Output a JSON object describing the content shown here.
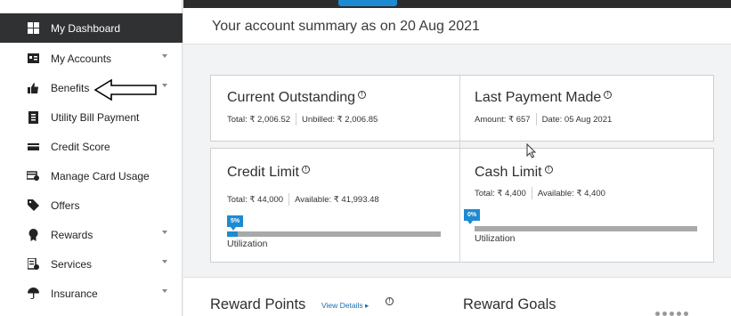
{
  "sidebar": {
    "items": [
      {
        "label": "My Dashboard",
        "icon": "dashboard-grid-icon",
        "active": true,
        "expandable": false
      },
      {
        "label": "My Accounts",
        "icon": "accounts-card-icon",
        "active": false,
        "expandable": true
      },
      {
        "label": "Benefits",
        "icon": "thumbs-up-icon",
        "active": false,
        "expandable": true
      },
      {
        "label": "Utility Bill Payment",
        "icon": "bill-icon",
        "active": false,
        "expandable": false
      },
      {
        "label": "Credit Score",
        "icon": "credit-score-icon",
        "active": false,
        "expandable": false
      },
      {
        "label": "Manage Card Usage",
        "icon": "manage-card-icon",
        "active": false,
        "expandable": false
      },
      {
        "label": "Offers",
        "icon": "tag-icon",
        "active": false,
        "expandable": false
      },
      {
        "label": "Rewards",
        "icon": "rewards-icon",
        "active": false,
        "expandable": true
      },
      {
        "label": "Services",
        "icon": "services-icon",
        "active": false,
        "expandable": true
      },
      {
        "label": "Insurance",
        "icon": "umbrella-icon",
        "active": false,
        "expandable": true
      }
    ]
  },
  "summary": {
    "title": "Your account summary as on 20 Aug 2021"
  },
  "cards": {
    "current_outstanding": {
      "title": "Current Outstanding",
      "total": "Total: ₹ 2,006.52",
      "unbilled": "Unbilled: ₹ 2,006.85"
    },
    "last_payment": {
      "title": "Last Payment Made",
      "amount": "Amount: ₹ 657",
      "date": "Date: 05 Aug 2021"
    },
    "credit_limit": {
      "title": "Credit Limit",
      "total": "Total: ₹ 44,000",
      "available": "Available: ₹ 41,993.48",
      "utilization_badge": "5%",
      "utilization_fraction": 0.05,
      "utilization_label": "Utilization"
    },
    "cash_limit": {
      "title": "Cash Limit",
      "total": "Total: ₹ 4,400",
      "available": "Available: ₹ 4,400",
      "utilization_badge": "0%",
      "utilization_fraction": 0.0,
      "utilization_label": "Utilization"
    }
  },
  "bottom": {
    "reward_points_title": "Reward Points",
    "view_details": "View Details ▸",
    "reward_goals_title": "Reward Goals"
  },
  "colors": {
    "accent": "#1e8ad1",
    "sidebar_active": "#2f3133",
    "annotation_arrow": "#000000"
  }
}
